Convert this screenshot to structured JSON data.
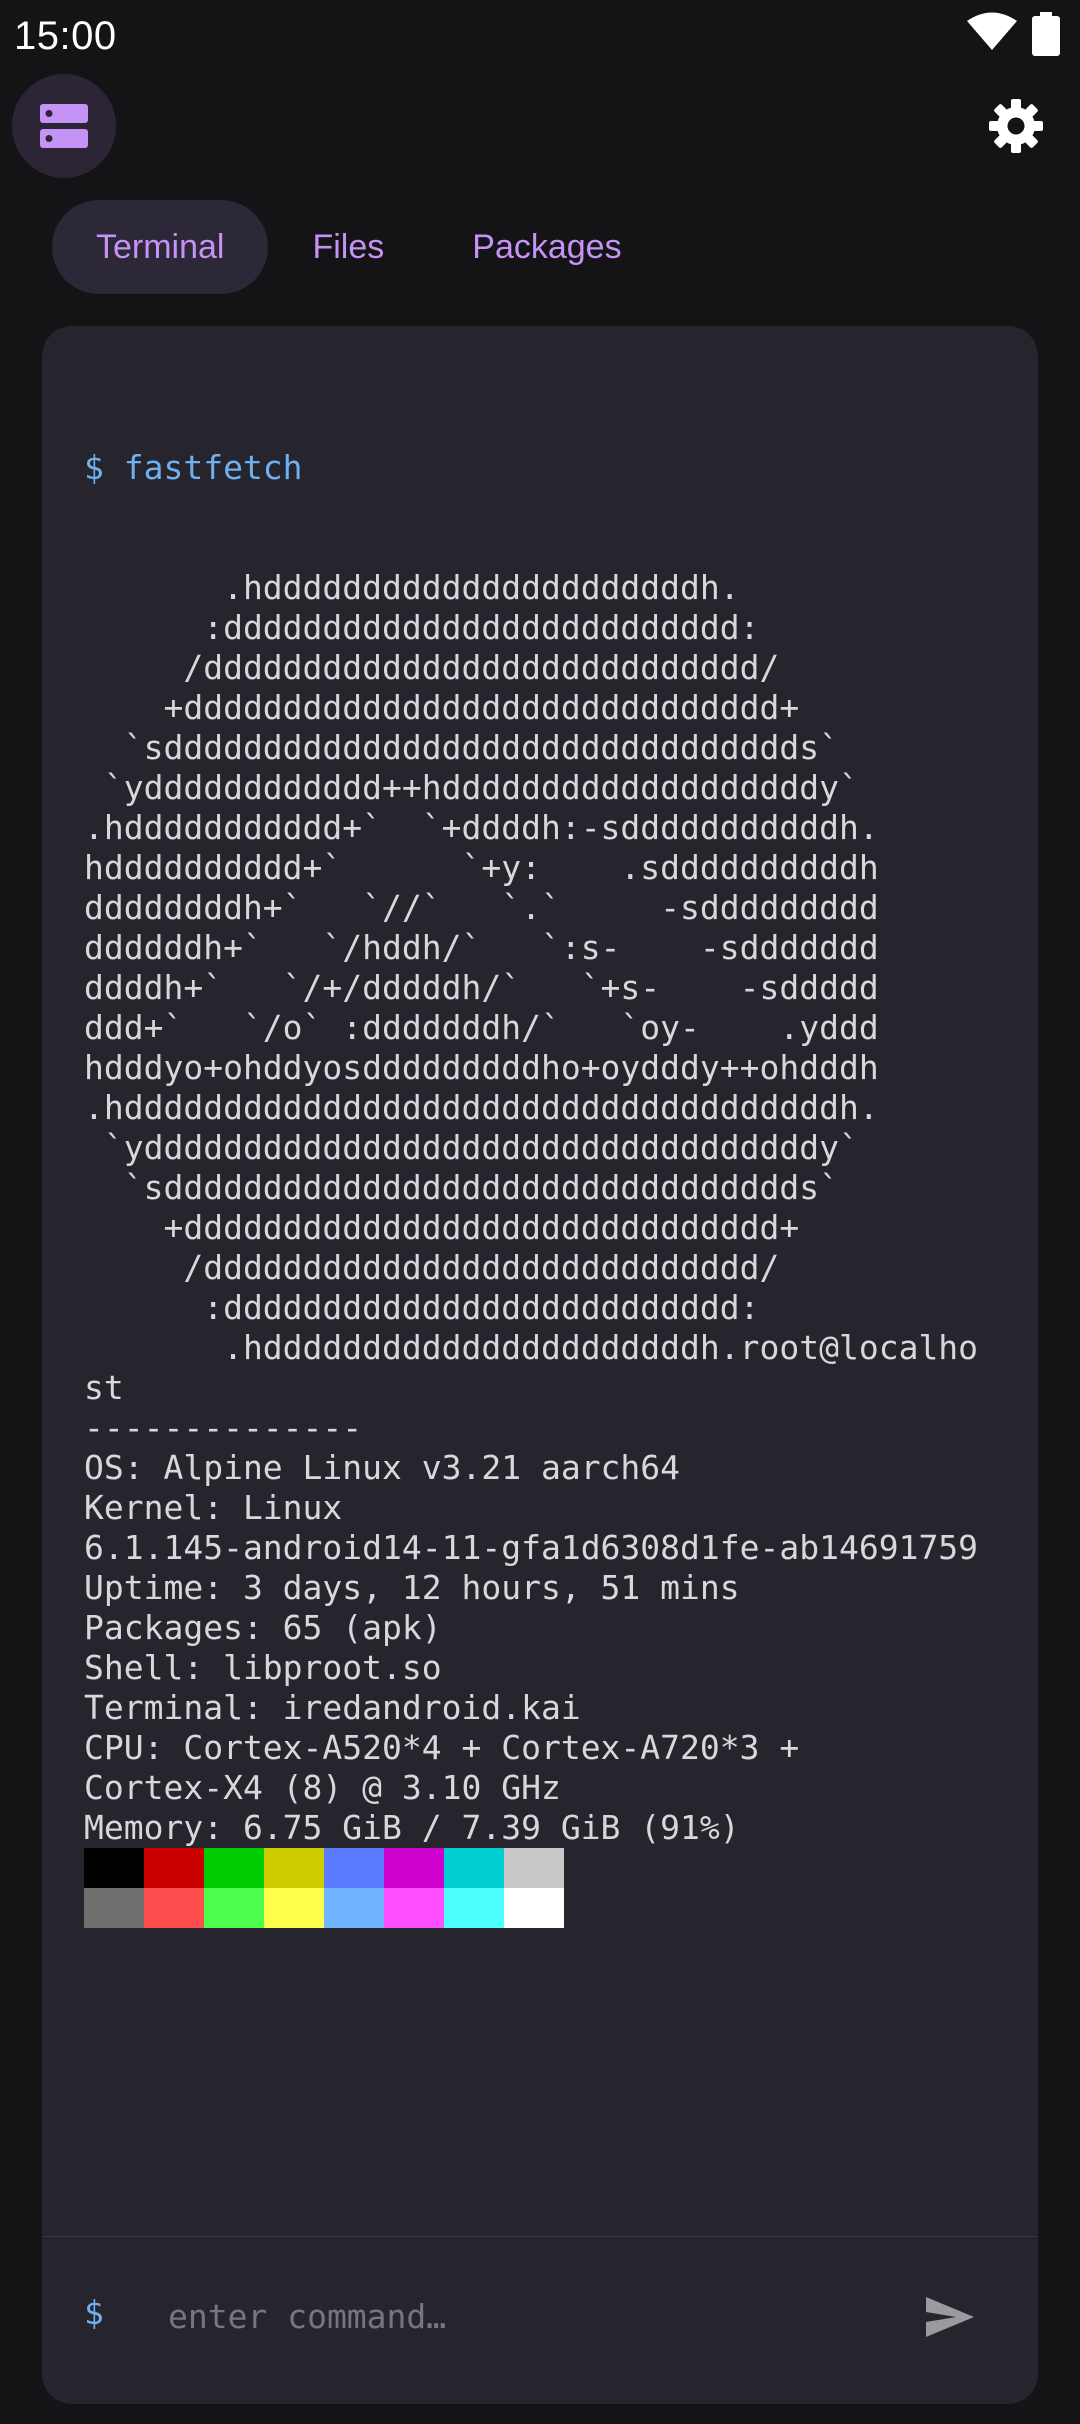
{
  "status": {
    "time": "15:00"
  },
  "icons": {
    "server": "server-icon",
    "settings": "gear-icon",
    "wifi": "wifi-icon",
    "battery": "battery-icon",
    "send": "send-icon"
  },
  "tabs": [
    {
      "label": "Terminal",
      "active": true
    },
    {
      "label": "Files",
      "active": false
    },
    {
      "label": "Packages",
      "active": false
    }
  ],
  "terminal": {
    "command_line": "$ fastfetch",
    "output_lines": [
      "       .hddddddddddddddddddddddh.",
      "      :dddddddddddddddddddddddddd:",
      "     /dddddddddddddddddddddddddddd/",
      "    +dddddddddddddddddddddddddddddd+",
      "  `sdddddddddddddddddddddddddddddddds`",
      " `ydddddddddddd++hdddddddddddddddddddy`",
      ".hddddddddddd+`  `+ddddh:-sdddddddddddh.",
      "hdddddddddd+`      `+y:    .sddddddddddh",
      "ddddddddh+`   `//`   `.`     -sddddddddd",
      "ddddddh+`   `/hddh/`   `:s-    -sddddddd",
      "ddddh+`   `/+/dddddh/`   `+s-    -sddddd",
      "ddd+`   `/o` :dddddddh/`   `oy-    .yddd",
      "hdddyo+ohddyosdddddddddho+oydddy++ohdddh",
      ".hddddddddddddddddddddddddddddddddddddh.",
      " `yddddddddddddddddddddddddddddddddddy`",
      "  `sdddddddddddddddddddddddddddddddds`",
      "    +dddddddddddddddddddddddddddddd+",
      "     /dddddddddddddddddddddddddddd/",
      "      :dddddddddddddddddddddddddd:",
      "       .hddddddddddddddddddddddh.root@localho",
      "st",
      "--------------",
      "OS: Alpine Linux v3.21 aarch64",
      "Kernel: Linux",
      "6.1.145-android14-11-gfa1d6308d1fe-ab14691759",
      "Uptime: 3 days, 12 hours, 51 mins",
      "Packages: 65 (apk)",
      "Shell: libproot.so",
      "Terminal: iredandroid.kai",
      "CPU: Cortex-A520*4 + Cortex-A720*3 +",
      "Cortex-X4 (8) @ 3.10 GHz",
      "Memory: 6.75 GiB / 7.39 GiB (91%)"
    ],
    "palette_row1": [
      "#000000",
      "#cd0000",
      "#00cd00",
      "#cdcd00",
      "#5c7cff",
      "#cd00cd",
      "#00cdcd",
      "#c8c8c8"
    ],
    "palette_row2": [
      "#6e6e6e",
      "#ff4e4e",
      "#4eff4e",
      "#ffff4e",
      "#6fb4ff",
      "#ff4eff",
      "#4effff",
      "#ffffff"
    ]
  },
  "input": {
    "prompt": "$",
    "placeholder": "enter command…",
    "value": ""
  },
  "colors": {
    "accent": "#c592f5",
    "prompt": "#6fb0f0",
    "panel": "#26252e",
    "background": "#141416"
  }
}
